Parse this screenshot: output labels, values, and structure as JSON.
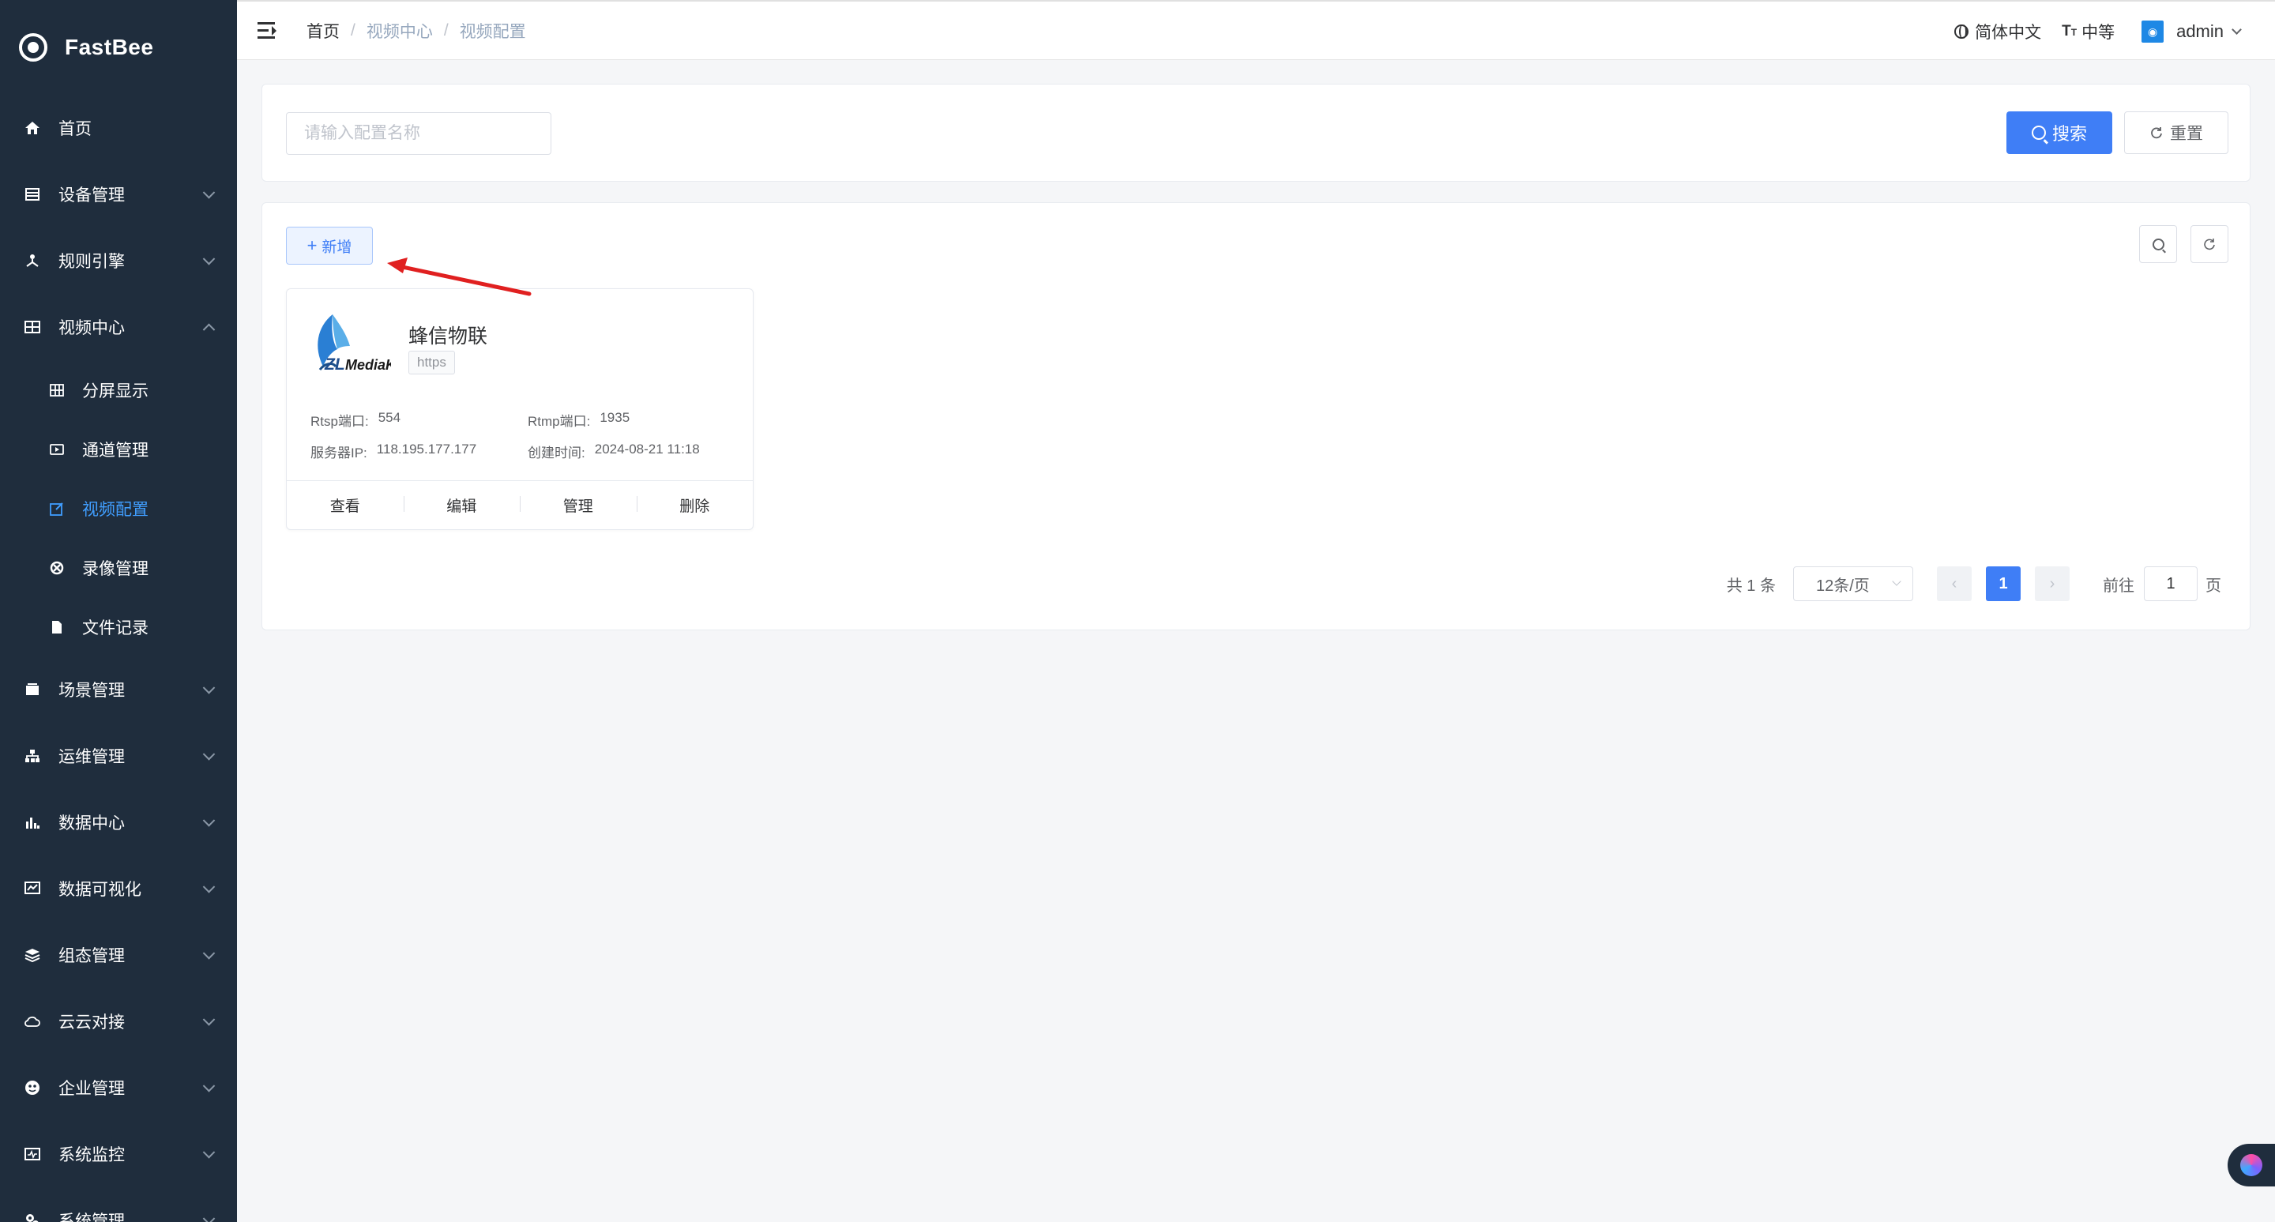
{
  "app": {
    "name": "FastBee"
  },
  "sidebar": {
    "items": [
      {
        "label": "首页",
        "icon": "home-icon"
      },
      {
        "label": "设备管理",
        "icon": "device-icon"
      },
      {
        "label": "规则引擎",
        "icon": "rule-icon"
      },
      {
        "label": "视频中心",
        "icon": "video-center-icon",
        "expanded": true,
        "children": [
          {
            "label": "分屏显示",
            "icon": "grid-icon"
          },
          {
            "label": "通道管理",
            "icon": "channel-icon"
          },
          {
            "label": "视频配置",
            "icon": "edit-icon",
            "active": true
          },
          {
            "label": "录像管理",
            "icon": "record-icon"
          },
          {
            "label": "文件记录",
            "icon": "file-icon"
          }
        ]
      },
      {
        "label": "场景管理",
        "icon": "scene-icon"
      },
      {
        "label": "运维管理",
        "icon": "ops-icon"
      },
      {
        "label": "数据中心",
        "icon": "data-icon"
      },
      {
        "label": "数据可视化",
        "icon": "visual-icon"
      },
      {
        "label": "组态管理",
        "icon": "layers-icon"
      },
      {
        "label": "云云对接",
        "icon": "cloud-icon"
      },
      {
        "label": "企业管理",
        "icon": "company-icon"
      },
      {
        "label": "系统监控",
        "icon": "monitor-icon"
      },
      {
        "label": "系统管理",
        "icon": "settings-icon"
      }
    ]
  },
  "header": {
    "breadcrumb": [
      "首页",
      "视频中心",
      "视频配置"
    ],
    "language": "简体中文",
    "size": "中等",
    "user": "admin"
  },
  "search": {
    "placeholder": "请输入配置名称",
    "value": "",
    "search_label": "搜索",
    "reset_label": "重置"
  },
  "toolbar": {
    "add_label": "新增"
  },
  "cards": [
    {
      "logo_text": "ZLMediaKit",
      "title": "蜂信物联",
      "tag": "https",
      "rtsp_label": "Rtsp端口:",
      "rtsp_value": "554",
      "rtmp_label": "Rtmp端口:",
      "rtmp_value": "1935",
      "ip_label": "服务器IP:",
      "ip_value": "118.195.177.177",
      "created_label": "创建时间:",
      "created_value": "2024-08-21 11:18",
      "actions": [
        "查看",
        "编辑",
        "管理",
        "删除"
      ]
    }
  ],
  "pagination": {
    "total_text": "共 1 条",
    "page_size": "12条/页",
    "current_page": "1",
    "goto_label": "前往",
    "goto_value": "1",
    "page_suffix": "页"
  },
  "colors": {
    "primary": "#3f7ef6",
    "sidebar": "#1f2d3d",
    "active_menu": "#409eff",
    "annotation_arrow": "#e02020"
  }
}
